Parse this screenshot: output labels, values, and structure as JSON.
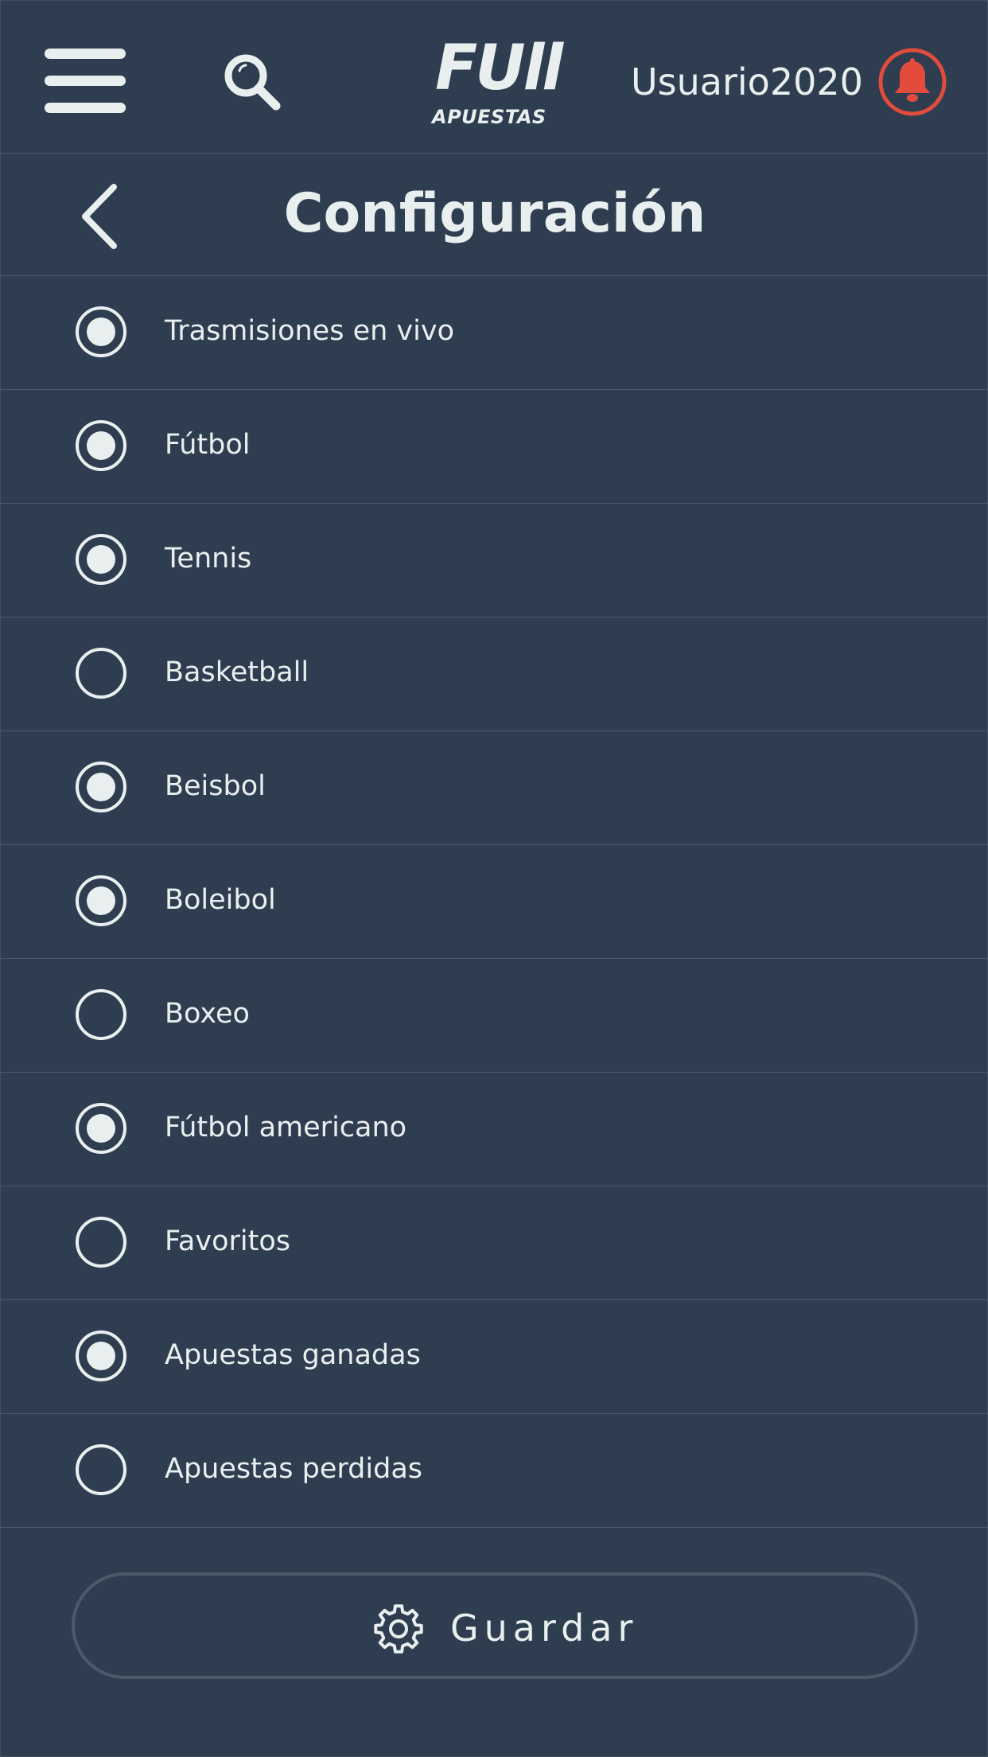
{
  "header": {
    "logo_main": "FUll",
    "logo_sub": "APUESTAS",
    "username": "Usuario2020",
    "icons": {
      "menu": "hamburger-menu-icon",
      "search": "search-icon",
      "notifications": "bell-icon"
    },
    "colors": {
      "notification_accent": "#e34c3d"
    }
  },
  "page": {
    "title": "Configuración",
    "back_icon": "chevron-left-icon"
  },
  "options": [
    {
      "label": "Trasmisiones en vivo",
      "selected": true
    },
    {
      "label": "Fútbol",
      "selected": true
    },
    {
      "label": "Tennis",
      "selected": true
    },
    {
      "label": "Basketball",
      "selected": false
    },
    {
      "label": "Beisbol",
      "selected": true
    },
    {
      "label": "Boleibol",
      "selected": true
    },
    {
      "label": "Boxeo",
      "selected": false
    },
    {
      "label": "Fútbol americano",
      "selected": true
    },
    {
      "label": "Favoritos",
      "selected": false
    },
    {
      "label": "Apuestas ganadas",
      "selected": true
    },
    {
      "label": "Apuestas perdidas",
      "selected": false
    }
  ],
  "save": {
    "label": "Guardar",
    "icon": "gear-icon"
  },
  "theme": {
    "background": "#2e3e50",
    "text": "#e9efef",
    "divider": "#4a5a6b"
  }
}
